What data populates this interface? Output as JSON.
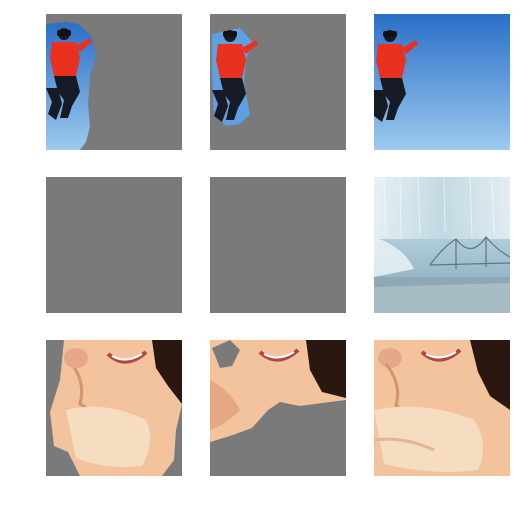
{
  "grid": {
    "rows": [
      {
        "name": "jumping-person",
        "tiles": [
          {
            "kind": "partial-mask-left"
          },
          {
            "kind": "subject-mask"
          },
          {
            "kind": "original"
          }
        ]
      },
      {
        "name": "waterfall-bridge",
        "tiles": [
          {
            "kind": "empty-mask"
          },
          {
            "kind": "empty-mask"
          },
          {
            "kind": "original"
          }
        ]
      },
      {
        "name": "woman-phone",
        "tiles": [
          {
            "kind": "partial-mask-bottom-corners"
          },
          {
            "kind": "partial-mask-bottom"
          },
          {
            "kind": "original"
          }
        ]
      }
    ]
  },
  "colors": {
    "mask_gray": "#7a7a7a",
    "sky_top": "#2a6fc7",
    "sky_bottom": "#9cc9ee",
    "jacket_red": "#e8311e",
    "pants_black": "#151a24",
    "waterfall_top": "#d7e8ef",
    "waterfall_bottom": "#7fa1b4",
    "skin": "#f2c39c",
    "hair": "#2a1710"
  }
}
